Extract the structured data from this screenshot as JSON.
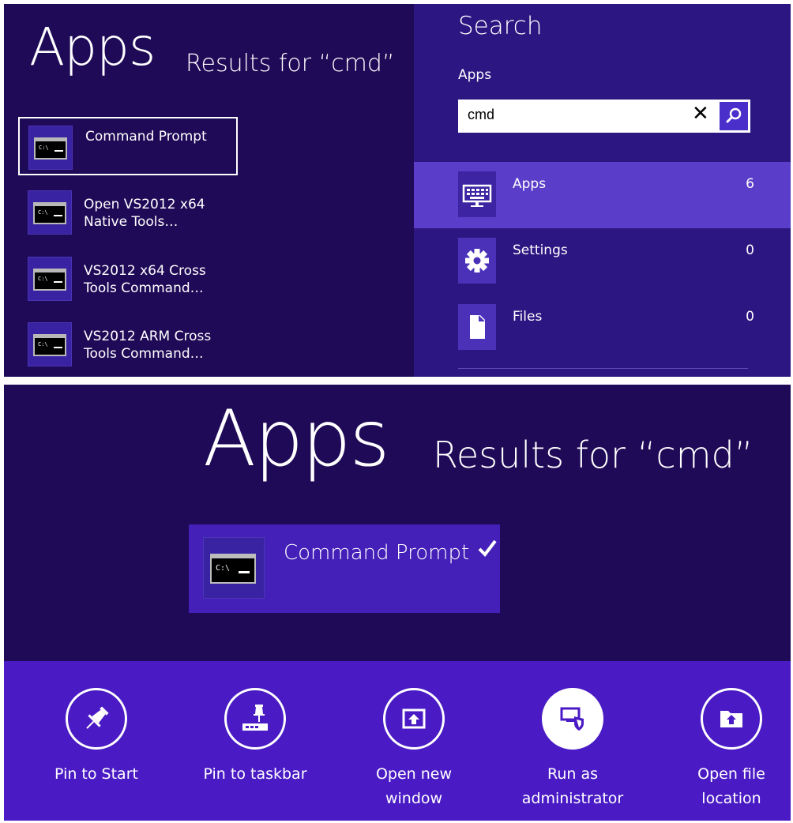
{
  "search_results_panel": {
    "heading": "Apps",
    "results_for": "Results for “cmd”",
    "results": [
      {
        "label": "Command Prompt",
        "icon": "command-prompt-icon",
        "selected": true
      },
      {
        "label": "Open VS2012 x64\nNative Tools…",
        "icon": "command-prompt-icon"
      },
      {
        "label": "VS2012 x64 Cross\nTools Command…",
        "icon": "command-prompt-icon"
      },
      {
        "label": "VS2012 ARM Cross\nTools Command…",
        "icon": "command-prompt-icon"
      }
    ],
    "console_glyph": "C:\\"
  },
  "search_charm": {
    "title": "Search",
    "scope": "Apps",
    "query": "cmd",
    "clear_glyph": "✕",
    "categories": [
      {
        "label": "Apps",
        "count": "6",
        "icon": "apps-keyboard-icon",
        "active": true
      },
      {
        "label": "Settings",
        "count": "0",
        "icon": "settings-gear-icon"
      },
      {
        "label": "Files",
        "count": "0",
        "icon": "file-icon"
      }
    ]
  },
  "selection_view": {
    "heading": "Apps",
    "results_for": "Results for “cmd”",
    "selected_app": "Command Prompt",
    "selected_app_visible": "Command Prompt",
    "console_glyph": "C:\\"
  },
  "app_bar": {
    "commands": [
      {
        "label": "Pin to Start",
        "icon": "pin-icon"
      },
      {
        "label": "Pin to taskbar",
        "icon": "pin-taskbar-icon"
      },
      {
        "label": "Open new\nwindow",
        "icon": "new-window-icon"
      },
      {
        "label": "Run as\nadministrator",
        "icon": "shield-admin-icon",
        "filled": true
      },
      {
        "label": "Open file\nlocation",
        "icon": "folder-icon"
      }
    ]
  },
  "colors": {
    "background_dark": "#1f0a57",
    "charm_panel": "#2c1682",
    "accent": "#5a3ec9",
    "app_bar": "#4a1bc4"
  }
}
